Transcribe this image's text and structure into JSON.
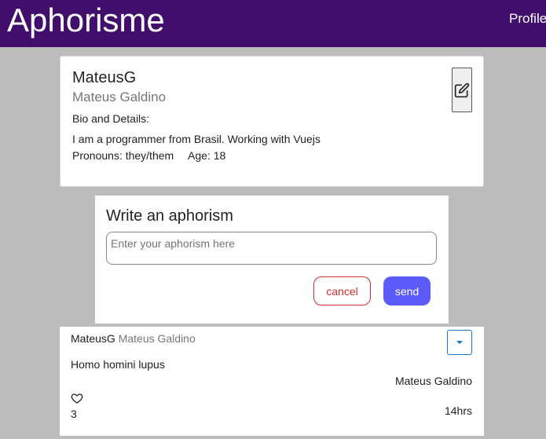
{
  "header": {
    "brand": "Aphorisme",
    "nav_profile": "Profile"
  },
  "profile": {
    "username": "MateusG",
    "full_name": "Mateus Galdino",
    "bio_title": "Bio and Details:",
    "bio_text": "I am a programmer from Brasil. Working with Vuejs",
    "pronouns": "Pronouns: they/them",
    "age": "Age: 18",
    "edit_icon": "edit-icon"
  },
  "compose": {
    "title": "Write an aphorism",
    "placeholder": "Enter your aphorism here",
    "value": "",
    "cancel_label": "cancel",
    "send_label": "send",
    "cancel_color": "#d0302f",
    "send_color": "#5b5bf7"
  },
  "post": {
    "username": "MateusG",
    "full_name": "Mateus Galdino",
    "text": "Homo homini lupus",
    "author": "Mateus Galdino",
    "likes": "3",
    "time": "14hrs",
    "dropdown_icon": "chevron-down-icon",
    "like_icon": "heart-icon"
  },
  "colors": {
    "header_bg": "#410f6b",
    "page_bg": "#bcbcbc",
    "muted_text": "#777777",
    "dropdown_border": "#1976d2"
  }
}
